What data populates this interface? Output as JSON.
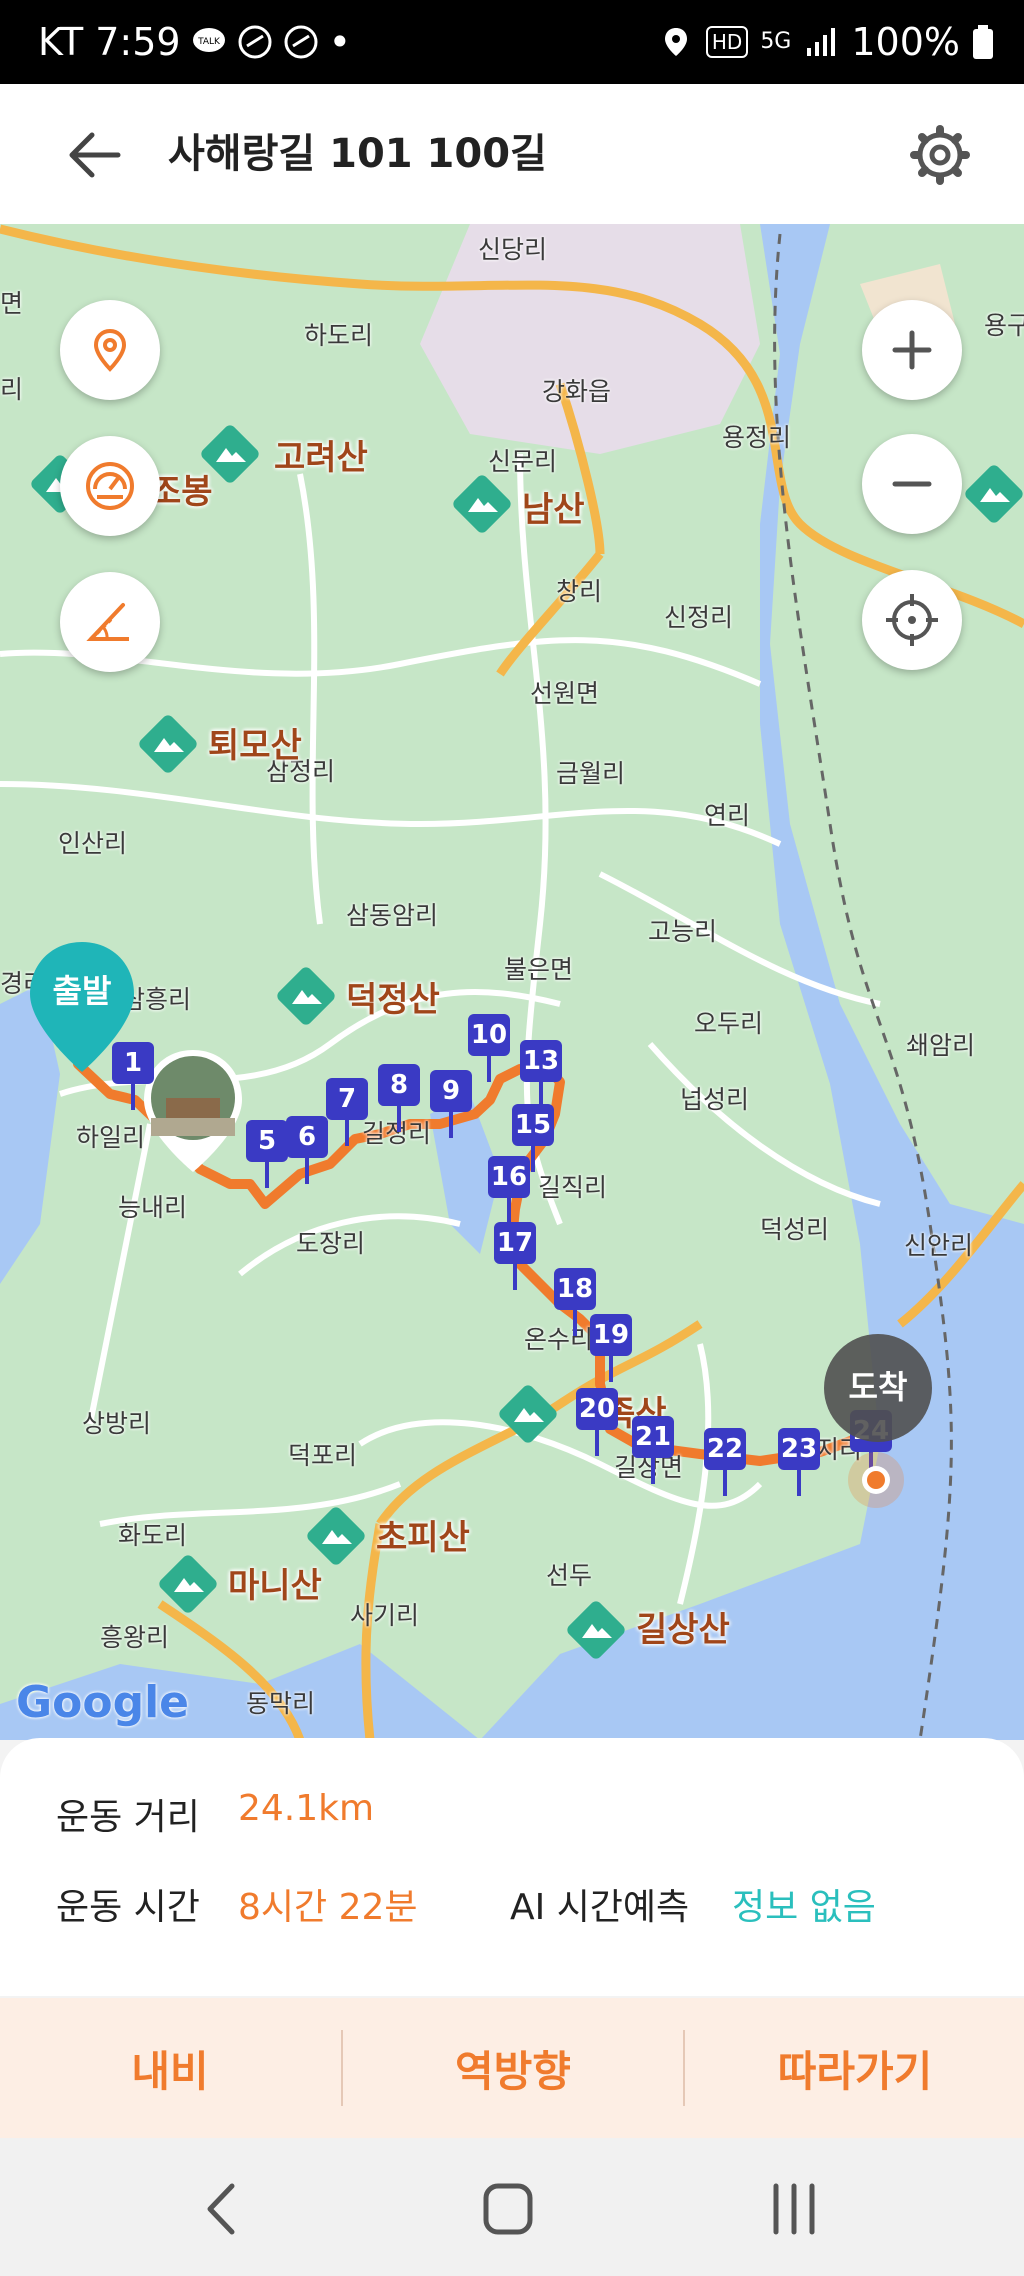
{
  "status": {
    "carrier_time": "KT 7:59",
    "battery": "100%",
    "dot": "•",
    "hd": "HD",
    "net": "5G"
  },
  "header": {
    "title": "사해랑길 101 100길",
    "back_icon": "back-arrow-icon",
    "settings_icon": "gear-icon"
  },
  "map": {
    "start_label": "출발",
    "end_label": "도착",
    "google_logo": "Google",
    "places": {
      "sindangri": "신당리",
      "myeon": "면",
      "hadori": "하도리",
      "ganghwaeup": "강화읍",
      "yongjeongri": "용정리",
      "yonggu": "용구",
      "sinmunri": "신문리",
      "ri": "리",
      "changri": "창리",
      "sinjeongri": "신정리",
      "seonwonmyeon": "선원면",
      "samjeongri": "삼정리",
      "geumwolri": "금월리",
      "yeonri": "연리",
      "insanri": "인산리",
      "samdongamri": "삼동암리",
      "goneungri": "고능리",
      "bureunmyeon": "불은면",
      "gyeongri": "경리",
      "samheungri": "삼흥리",
      "odurl": "오두리",
      "soeamri": "쇄암리",
      "hailri": "하일리",
      "giljeongri": "길정리",
      "neopseongri": "넙성리",
      "neungnaeri": "능내리",
      "giljikri": "길직리",
      "dojangri": "도장리",
      "deokseongri": "덕성리",
      "sinanri": "신안리",
      "onsuri": "온수리",
      "sangbangri": "상방리",
      "deokpori": "덕포리",
      "gilsangmyeon": "길상면",
      "hwadori": "화도리",
      "sagiri": "사기리",
      "seondu": "선두",
      "heungwangri": "흥왕리",
      "dongmakri": "동막리",
      "jeondeung": "정족산",
      "jiri": "지리"
    },
    "mountains": {
      "goryeosan": "고려산",
      "bong": "조봉",
      "namsan": "남산",
      "toemosan": "퇴모산",
      "deokjeongsan": "덕정산",
      "chopisan": "초피산",
      "manisan": "마니산",
      "gilsangsan": "길상산",
      "jeongjok": "족산"
    },
    "waypoints": [
      "1",
      "5",
      "6",
      "7",
      "8",
      "9",
      "10",
      "13",
      "15",
      "16",
      "17",
      "18",
      "19",
      "20",
      "21",
      "22",
      "23",
      "24"
    ],
    "controls": {
      "location_pin": "location-pin-icon",
      "speedometer": "speedometer-icon",
      "slope": "slope-icon",
      "zoom_in": "plus-icon",
      "zoom_out": "minus-icon",
      "crosshair": "crosshair-icon"
    }
  },
  "info": {
    "distance_label": "운동 거리",
    "distance_value": "24.1km",
    "time_label": "운동 시간",
    "time_value": "8시간 22분",
    "ai_label": "AI 시간예측",
    "ai_value": "정보 없음"
  },
  "actions": {
    "navi": "내비",
    "reverse": "역방향",
    "follow": "따라가기"
  },
  "colors": {
    "accent": "#f07b2d",
    "teal": "#2abfbd",
    "waypoint": "#3a3ac4"
  }
}
